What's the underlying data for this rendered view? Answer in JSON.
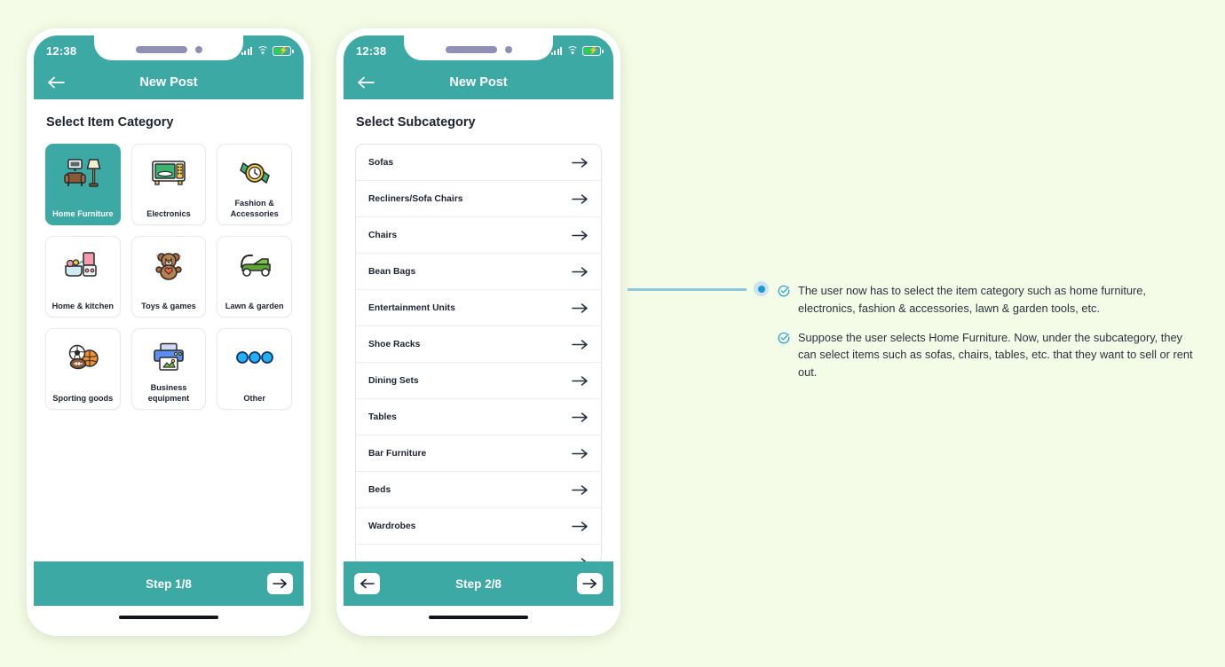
{
  "background_color": "#f4fbe6",
  "accent_color": "#3da9a4",
  "annotation_color": "#2196d3",
  "phone1": {
    "status": {
      "time": "12:38",
      "battery_icon": "battery-charging-icon",
      "wifi_icon": "wifi-icon",
      "signal_icon": "signal-bars-icon"
    },
    "appbar": {
      "title": "New Post",
      "back_icon": "back-arrow-icon"
    },
    "section_title": "Select Item Category",
    "categories": [
      {
        "label": "Home Furniture",
        "icon": "armchair-lamp-icon",
        "selected": true
      },
      {
        "label": "Electronics",
        "icon": "microwave-icon",
        "selected": false
      },
      {
        "label": "Fashion & Accessories",
        "icon": "wristwatch-icon",
        "selected": false
      },
      {
        "label": "Home & kitchen",
        "icon": "blender-icon",
        "selected": false
      },
      {
        "label": "Toys & games",
        "icon": "teddy-bear-icon",
        "selected": false
      },
      {
        "label": "Lawn & garden",
        "icon": "lawn-mower-icon",
        "selected": false
      },
      {
        "label": "Sporting goods",
        "icon": "sports-balls-icon",
        "selected": false
      },
      {
        "label": "Business equipment",
        "icon": "printer-icon",
        "selected": false
      },
      {
        "label": "Other",
        "icon": "three-dots-icon",
        "selected": false
      }
    ],
    "step": {
      "text": "Step 1/8",
      "next_icon": "arrow-right-icon"
    }
  },
  "phone2": {
    "status": {
      "time": "12:38",
      "battery_icon": "battery-charging-icon",
      "wifi_icon": "wifi-icon",
      "signal_icon": "signal-bars-icon"
    },
    "appbar": {
      "title": "New Post",
      "back_icon": "back-arrow-icon"
    },
    "section_title": "Select Subcategory",
    "subcategories": [
      {
        "label": "Sofas"
      },
      {
        "label": "Recliners/Sofa Chairs"
      },
      {
        "label": "Chairs"
      },
      {
        "label": "Bean Bags"
      },
      {
        "label": "Entertainment Units"
      },
      {
        "label": "Shoe Racks"
      },
      {
        "label": "Dining Sets"
      },
      {
        "label": "Tables"
      },
      {
        "label": "Bar Furniture"
      },
      {
        "label": "Beds"
      },
      {
        "label": "Wardrobes"
      },
      {
        "label": ""
      }
    ],
    "step": {
      "text": "Step 2/8",
      "prev_icon": "arrow-left-icon",
      "next_icon": "arrow-right-icon"
    }
  },
  "annotation": {
    "anchor_icon": "anchor-dot-icon",
    "notes": [
      {
        "icon": "check-circle-icon",
        "text": "The user now has to select the item category such as home furniture, electronics, fashion & accessories, lawn & garden tools, etc."
      },
      {
        "icon": "check-circle-icon",
        "text": "Suppose the user selects Home Furniture. Now, under the subcategory, they can select items such as sofas, chairs, tables, etc. that they want to sell or rent out."
      }
    ]
  }
}
